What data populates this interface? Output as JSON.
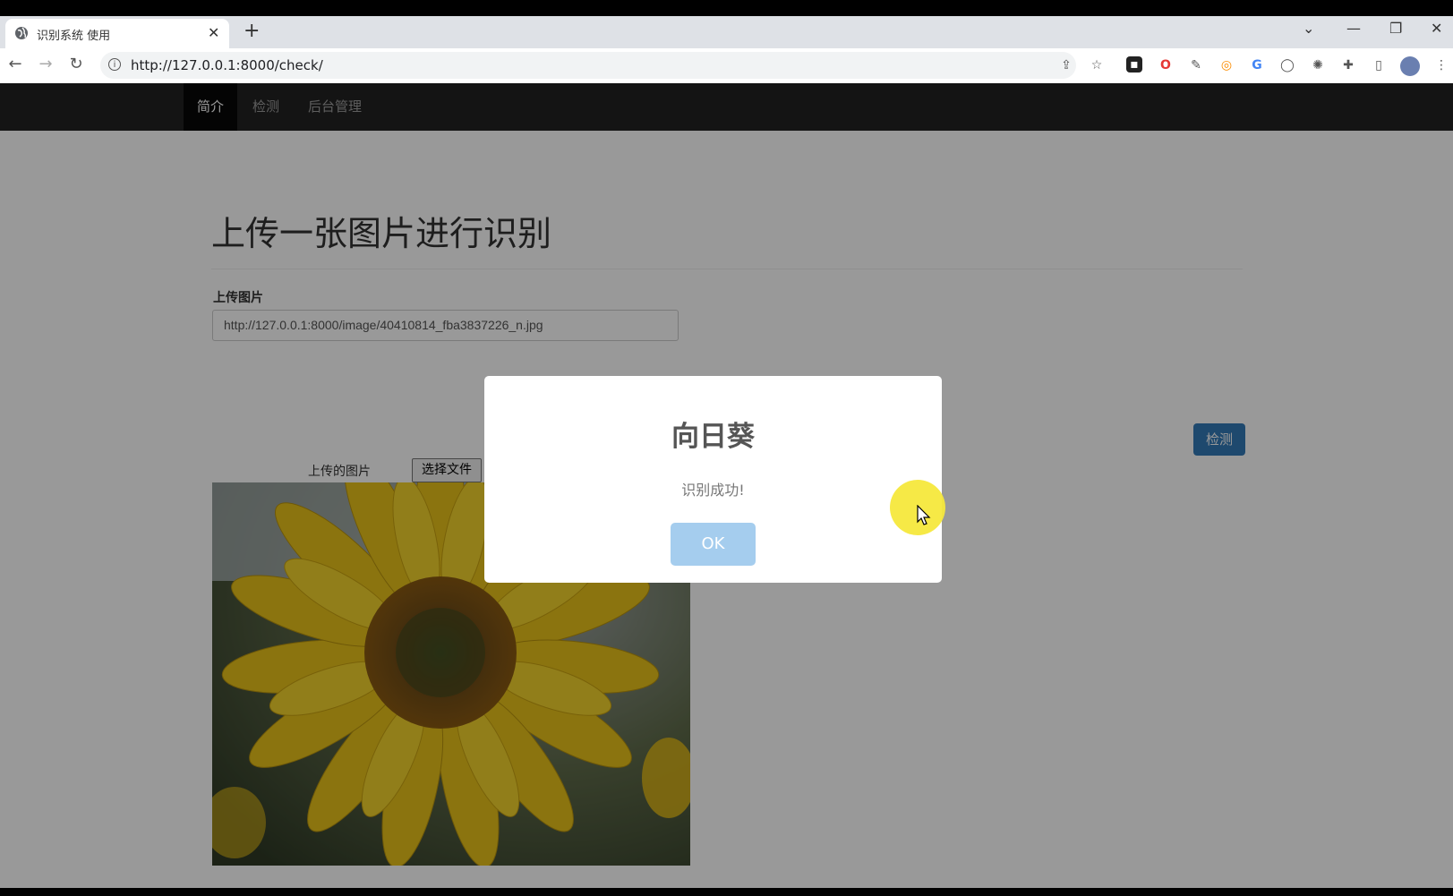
{
  "browser": {
    "tab_title": "识别系统 使用",
    "url": "http://127.0.0.1:8000/check/"
  },
  "navbar": {
    "items": [
      {
        "label": "简介",
        "active": true
      },
      {
        "label": "检测",
        "active": false
      },
      {
        "label": "后台管理",
        "active": false
      }
    ]
  },
  "main": {
    "heading": "上传一张图片进行识别",
    "upload_label": "上传图片",
    "upload_value": "http://127.0.0.1:8000/image/40410814_fba3837226_n.jpg",
    "choose_file_label": "选择文件",
    "detect_button": "检测",
    "image_caption": "上传的图片"
  },
  "modal": {
    "title": "向日葵",
    "text": "识别成功!",
    "ok_label": "OK"
  },
  "colors": {
    "navbar_bg": "#222222",
    "primary": "#337ab7",
    "ok_button": "#a5cdee",
    "cursor_highlight": "#f5e83c"
  }
}
